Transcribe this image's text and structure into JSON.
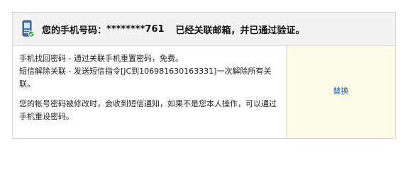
{
  "header": {
    "title": "您的手机号码：",
    "masked_number": "********761",
    "status": "已经关联邮箱，并已通过验证。"
  },
  "content": {
    "line1": "手机找回密码 - 通过关联手机重置密码，免费。",
    "line2": "短信解除关联 - 发送短信指令[JC到106981630163331]一次解除所有关联。",
    "line3": "您的帐号密码被修改时，会收到短信通知，如果不是您本人操作，可以通过手机重设密码。"
  },
  "actions": {
    "replace_label": "替换"
  },
  "colors": {
    "link": "#1e5aa8",
    "header_bg": "#f3f3f3",
    "action_bg": "#fbfbe7"
  },
  "icons": {
    "header": "mobile-phone-icon"
  }
}
